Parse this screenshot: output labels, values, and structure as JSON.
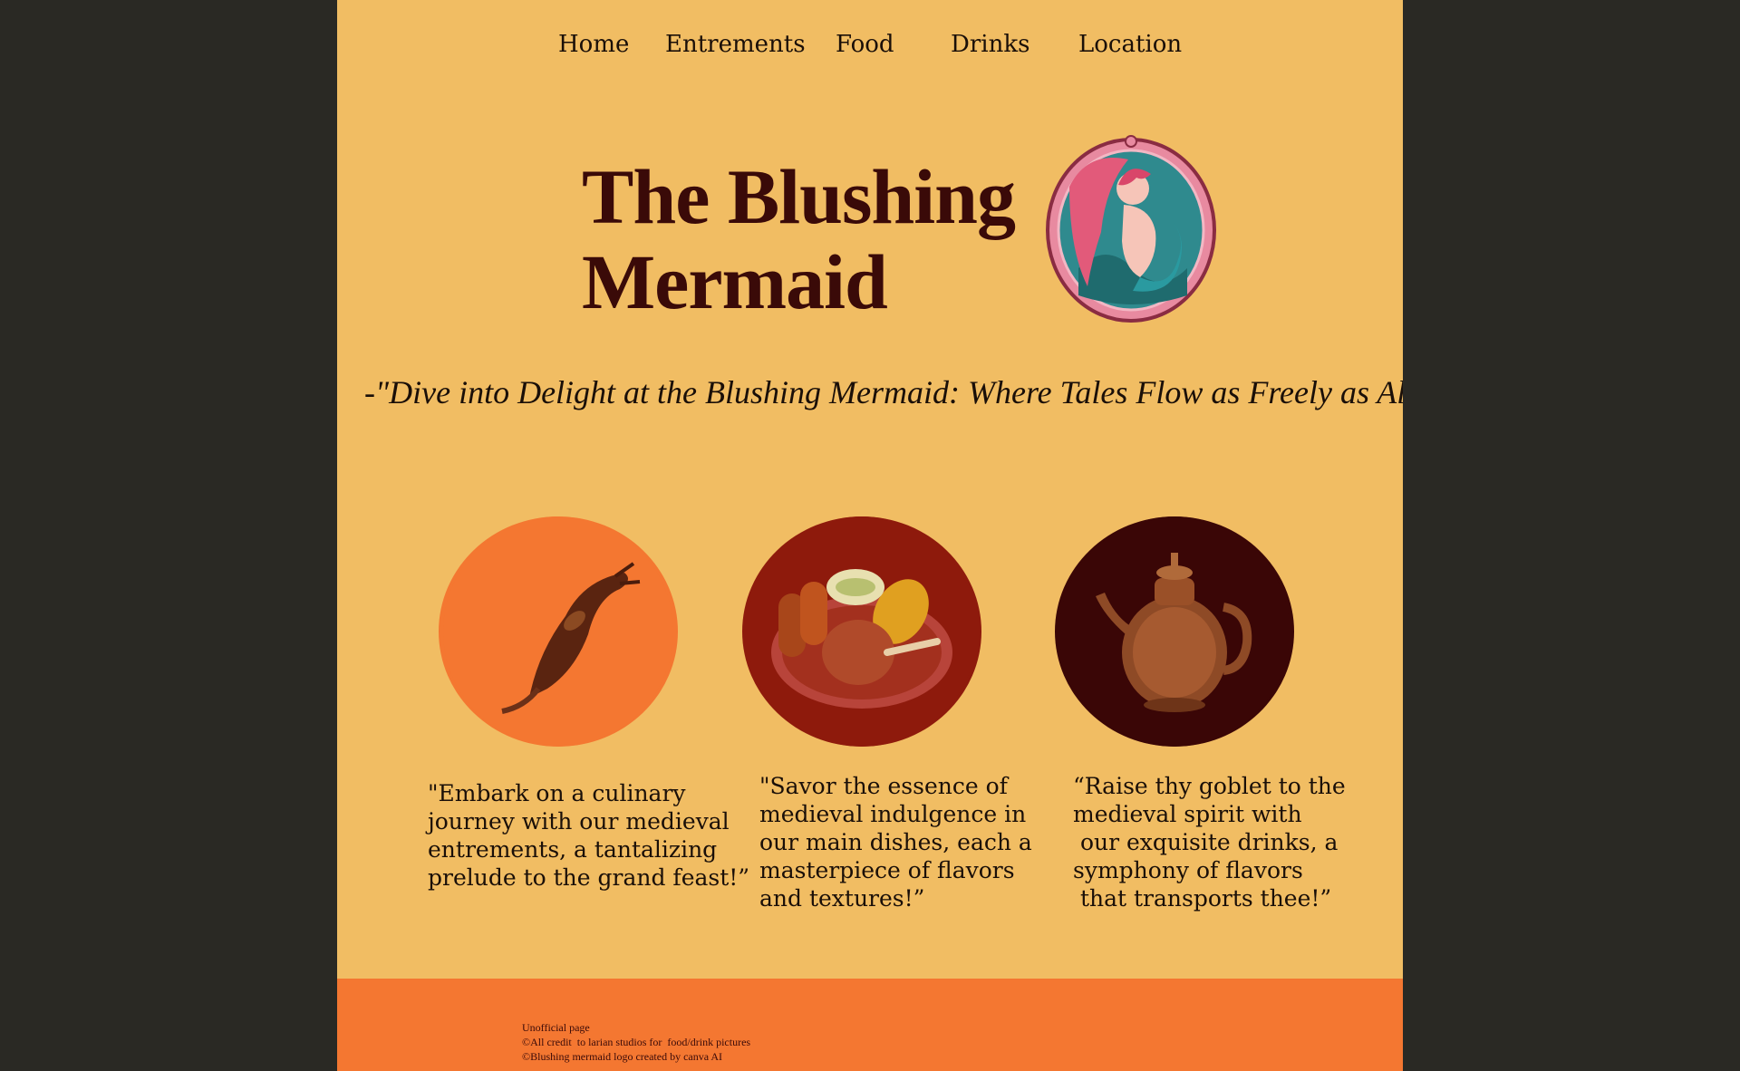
{
  "nav": {
    "home": "Home",
    "entrements": "Entrements",
    "food": "Food",
    "drinks": "Drinks",
    "location": "Location"
  },
  "hero": {
    "title_line1": "The Blushing",
    "title_line2": "Mermaid",
    "tagline": "-\"Dive into Delight at the Blushing Mermaid: Where Tales Flow as Freely as Ale!\""
  },
  "features": [
    {
      "icon": "roast-rat-icon",
      "bg": "#f47731",
      "caption": "\"Embark on a culinary\njourney with our medieval\nentrements, a tantalizing\nprelude to the grand feast!”"
    },
    {
      "icon": "feast-plate-icon",
      "bg": "#8e1a0c",
      "caption": "\"Savor the essence of\nmedieval indulgence in\nour main dishes, each a\nmasterpiece of flavors\nand textures!”"
    },
    {
      "icon": "teapot-icon",
      "bg": "#3a0606",
      "caption": "“Raise thy goblet to the\nmedieval spirit with\n our exquisite drinks, a\nsymphony of flavors\n that transports thee!”"
    }
  ],
  "footer": {
    "line1": "Unofficial page",
    "line2": "©All credit  to larian studios for  food/drink pictures",
    "line3": "©Blushing mermaid logo created by canva AI"
  },
  "colors": {
    "page_bg": "#f1bd63",
    "outer_bg": "#2a2924",
    "title": "#3a0a08",
    "footer_bg": "#f47731"
  }
}
